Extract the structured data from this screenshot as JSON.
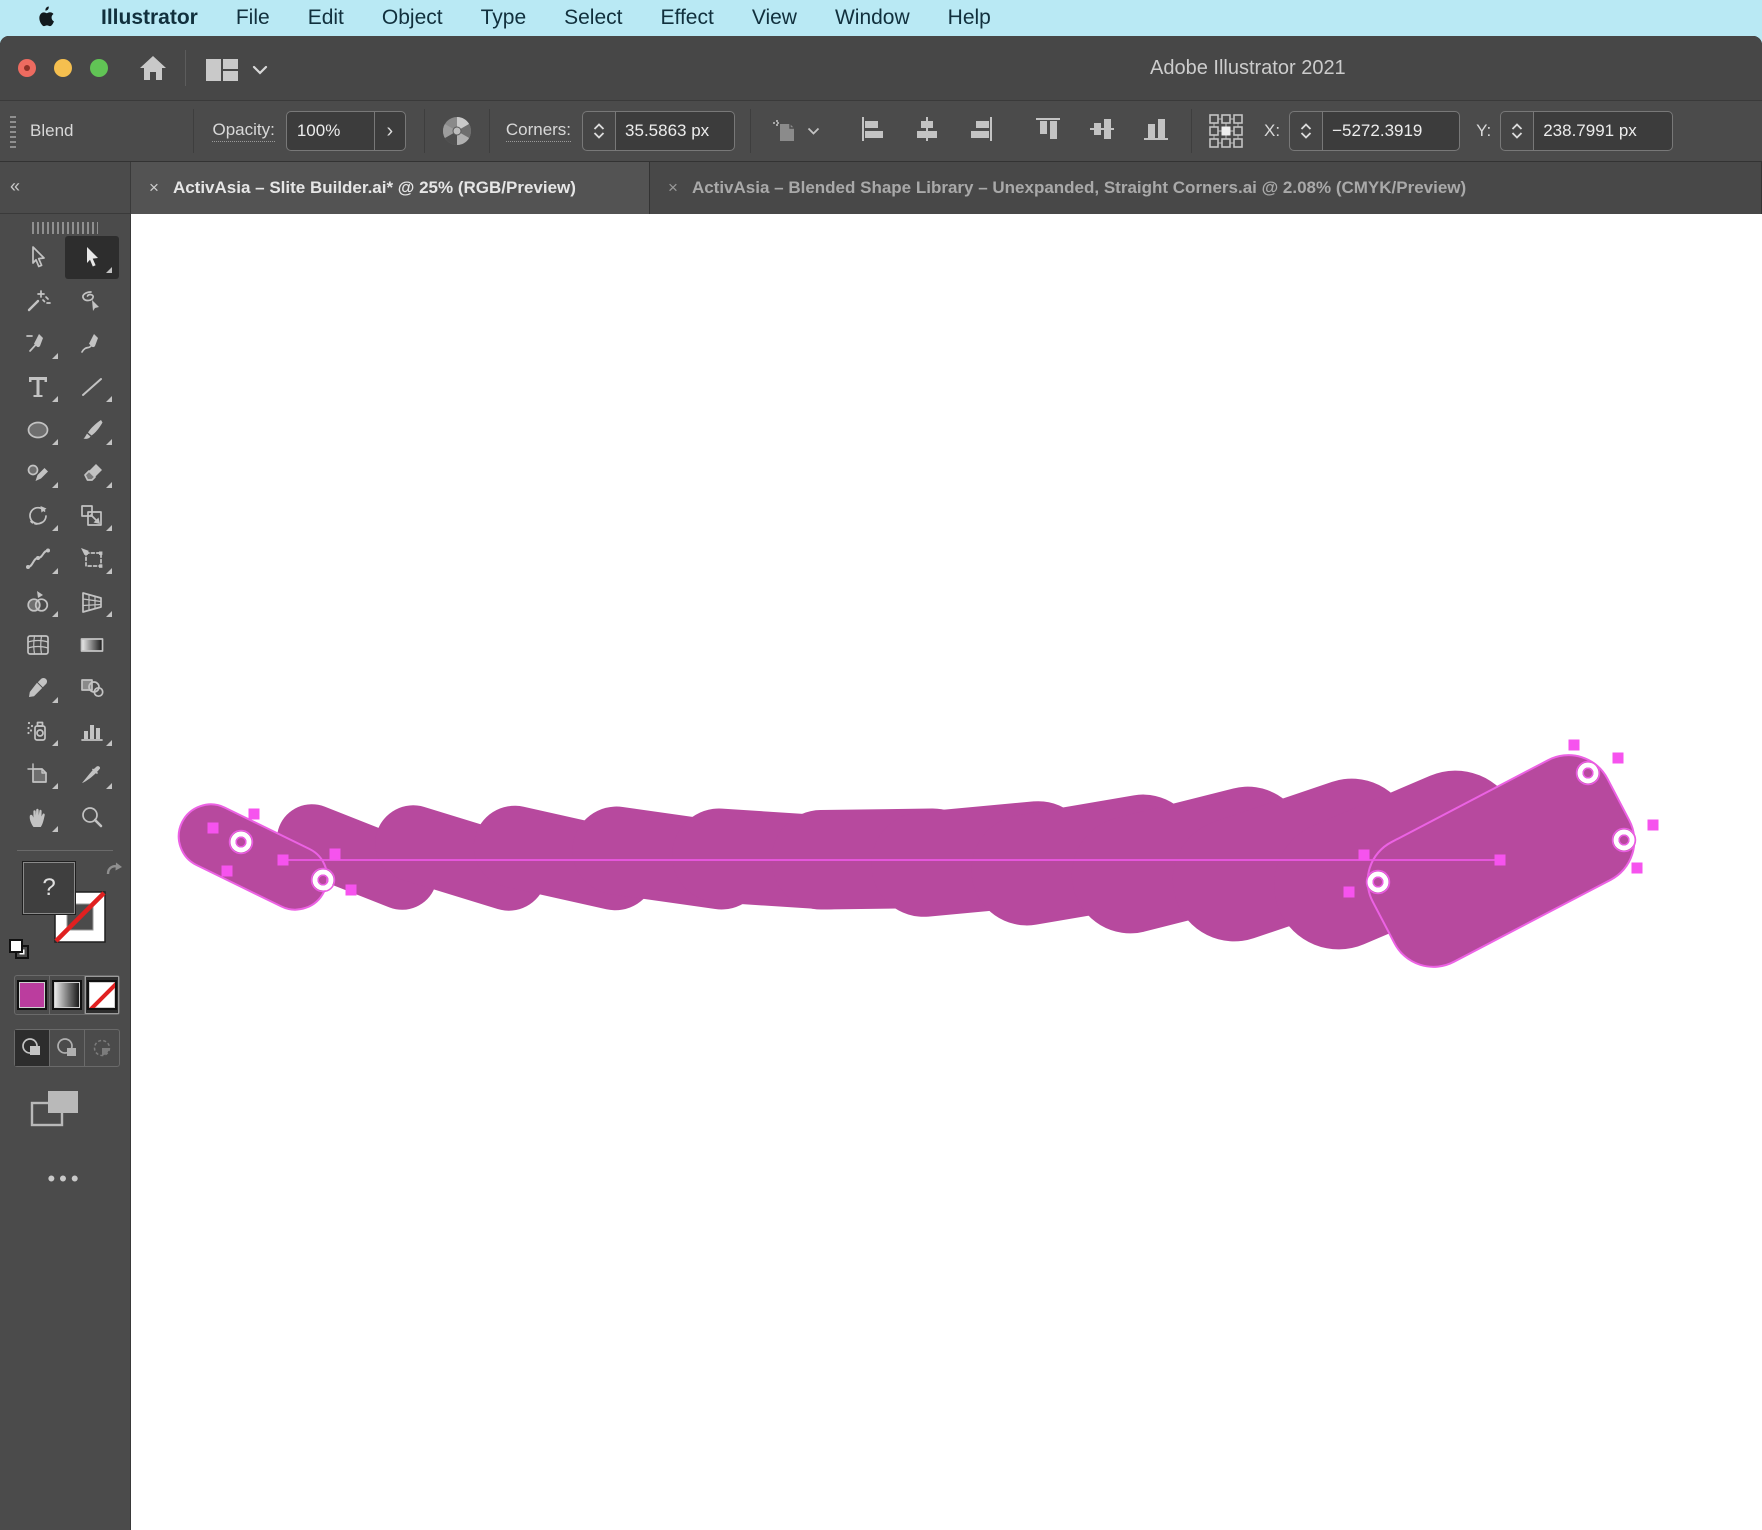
{
  "app": {
    "menu": [
      "Illustrator",
      "File",
      "Edit",
      "Object",
      "Type",
      "Select",
      "Effect",
      "View",
      "Window",
      "Help"
    ]
  },
  "titlebar": {
    "title": "Adobe Illustrator 2021"
  },
  "control_bar": {
    "panel_label": "Blend",
    "opacity_label": "Opacity:",
    "opacity_value": "100%",
    "opacity_more": "›",
    "corners_label": "Corners:",
    "corners_value": "35.5863 px",
    "x_label": "X:",
    "x_value": "−5272.3919",
    "y_label": "Y:",
    "y_value": "238.7991 px"
  },
  "tabs": [
    {
      "close": "×",
      "label": "ActivAsia – Slite Builder.ai* @ 25% (RGB/Preview)",
      "active": true
    },
    {
      "close": "×",
      "label": "ActivAsia – Blended Shape Library – Unexpanded, Straight Corners.ai @ 2.08% (CMYK/Preview)",
      "active": false
    }
  ],
  "toolbar": {
    "collapse": "«",
    "more": "•••",
    "fill_unknown": "?",
    "tools": [
      "selection",
      "direct-selection",
      "magic-wand",
      "lasso",
      "pen",
      "curvature",
      "type",
      "line-segment",
      "ellipse",
      "paintbrush",
      "shaper",
      "eraser",
      "rotate",
      "scale",
      "width",
      "free-transform",
      "shape-builder",
      "perspective-grid",
      "mesh",
      "gradient",
      "eyedropper",
      "blend",
      "symbol-sprayer",
      "column-graph",
      "artboard",
      "slice",
      "hand",
      "zoom"
    ],
    "active_tool": "direct-selection",
    "fill_swatch": "#bb3d9e",
    "stroke_swatch": "none"
  },
  "canvas": {
    "artwork": "blend of two rounded rectangles (selected)",
    "artwork_fill": "#b7499e",
    "selection_color": "#ec5ce4",
    "anchor_color": "#f653ee"
  }
}
